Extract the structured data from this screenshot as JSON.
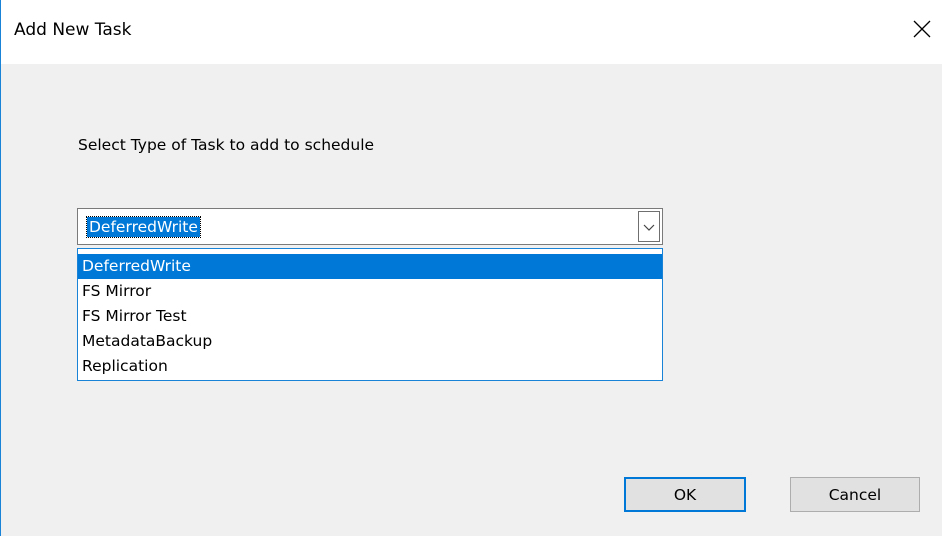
{
  "dialog": {
    "title": "Add New Task",
    "prompt": "Select Type of Task to add to schedule",
    "close_icon": "close-icon"
  },
  "task_type": {
    "selected_value": "DeferredWrite",
    "options": [
      {
        "label": "DeferredWrite",
        "selected": true
      },
      {
        "label": "FS Mirror",
        "selected": false
      },
      {
        "label": "FS Mirror Test",
        "selected": false
      },
      {
        "label": "MetadataBackup",
        "selected": false
      },
      {
        "label": "Replication",
        "selected": false
      }
    ],
    "arrow_icon": "chevron-down-icon"
  },
  "buttons": {
    "ok_label": "OK",
    "cancel_label": "Cancel"
  },
  "colors": {
    "accent": "#0078d7",
    "window_border": "#1883d7",
    "dialog_bg": "#f0f0f0",
    "button_bg": "#e1e1e1"
  }
}
